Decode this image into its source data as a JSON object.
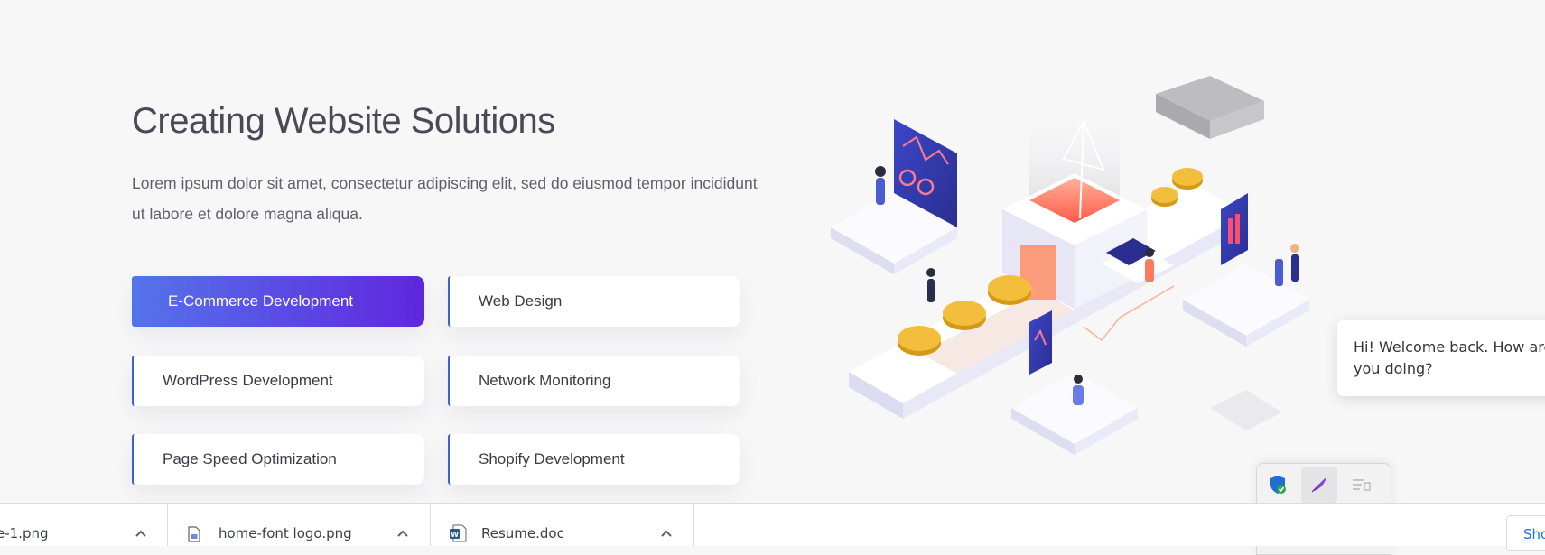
{
  "hero": {
    "title": "Creating Website Solutions",
    "description": "Lorem ipsum dolor sit amet, consectetur adipiscing elit, sed do eiusmod tempor incididunt ut labore et dolore magna aliqua."
  },
  "services": [
    {
      "label": "E-Commerce Development",
      "active": true
    },
    {
      "label": "Web Design",
      "active": false
    },
    {
      "label": "WordPress Development",
      "active": false
    },
    {
      "label": "Network Monitoring",
      "active": false
    },
    {
      "label": "Page Speed Optimization",
      "active": false
    },
    {
      "label": "Shopify Development",
      "active": false
    }
  ],
  "chat": {
    "message": "Hi! Welcome back. How are you doing?"
  },
  "tray": {
    "icons": [
      "security-shield-icon",
      "feather-pen-icon",
      "notification-icon",
      "coin-p-icon",
      "teams-icon"
    ]
  },
  "downloads": {
    "items": [
      {
        "name": "e-1.png",
        "icon": "image-file-icon"
      },
      {
        "name": "home-font logo.png",
        "icon": "image-file-icon"
      },
      {
        "name": "Resume.doc",
        "icon": "word-doc-icon"
      }
    ],
    "show_all_label": "Show all"
  },
  "colors": {
    "accent_start": "#5474ea",
    "accent_end": "#6026dd",
    "title": "#4a4a57",
    "link_blue": "#1a73e8"
  }
}
